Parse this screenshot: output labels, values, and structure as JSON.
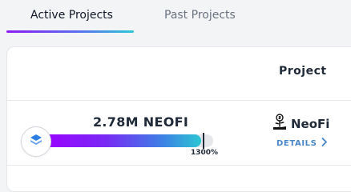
{
  "tabs": {
    "active_label": "Active Projects",
    "past_label": "Past Projects"
  },
  "table": {
    "header_project": "Project"
  },
  "row": {
    "amount": "2.78M NEOFI",
    "progress_label": "1300%",
    "progress_fraction": 0.93,
    "token_name": "NeoFi",
    "details_label": "DETAILS"
  },
  "icons": {
    "chain": "layers-icon",
    "token": "money-plant-icon",
    "details": "chevron-right-icon"
  },
  "colors": {
    "gradient_start": "#9b00ff",
    "gradient_end": "#2cc6d2",
    "link": "#4a86c8",
    "chain_icon": "#2f7de1"
  }
}
